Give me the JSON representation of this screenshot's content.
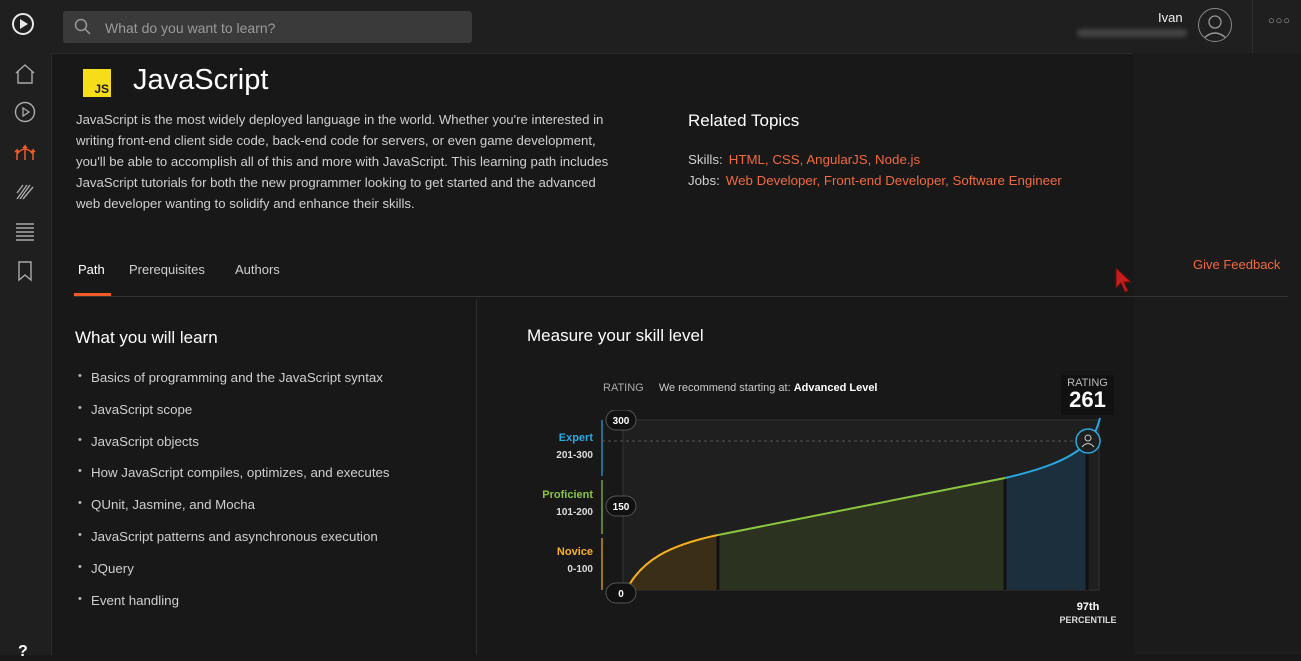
{
  "search": {
    "placeholder": "What do you want to learn?"
  },
  "user": {
    "name": "Ivan"
  },
  "topic": {
    "badge": "JS",
    "title": "JavaScript",
    "description": "JavaScript is the most widely deployed language in the world. Whether you're interested in writing front-end client side code, back-end code for servers, or even game development, you'll be able to accomplish all of this and more with JavaScript. This learning path includes JavaScript tutorials for both the new programmer looking to get started and the advanced web developer wanting to solidify and enhance their skills."
  },
  "related": {
    "title": "Related Topics",
    "skills_label": "Skills:",
    "skills": "HTML, CSS, AngularJS, Node.js",
    "jobs_label": "Jobs:",
    "jobs": "Web Developer, Front-end Developer, Software Engineer"
  },
  "tabs": [
    "Path",
    "Prerequisites",
    "Authors"
  ],
  "feedback": "Give Feedback",
  "learn": {
    "title": "What you will learn",
    "items": [
      "Basics of programming and the JavaScript syntax",
      "JavaScript scope",
      "JavaScript objects",
      "How JavaScript compiles, optimizes, and executes",
      "QUnit, Jasmine, and Mocha",
      "JavaScript patterns and asynchronous execution",
      "JQuery",
      "Event handling"
    ]
  },
  "skill": {
    "title": "Measure your skill level",
    "rating_label": "RATING",
    "recommend": "We recommend starting at:",
    "recommend_level": "Advanced Level",
    "box_label": "RATING",
    "rating": "261",
    "levels": [
      {
        "name": "Expert",
        "range": "201-300",
        "color": "#29a9e0"
      },
      {
        "name": "Proficient",
        "range": "101-200",
        "color": "#8cc63f"
      },
      {
        "name": "Novice",
        "range": "0-100",
        "color": "#f7b21b"
      }
    ],
    "ticks": [
      "300",
      "150",
      "0"
    ],
    "percentile": "97th",
    "percentile_label": "PERCENTILE"
  },
  "colors": {
    "accent": "#f15b2a",
    "link": "#f26a3d",
    "js_yellow": "#f5de19"
  }
}
